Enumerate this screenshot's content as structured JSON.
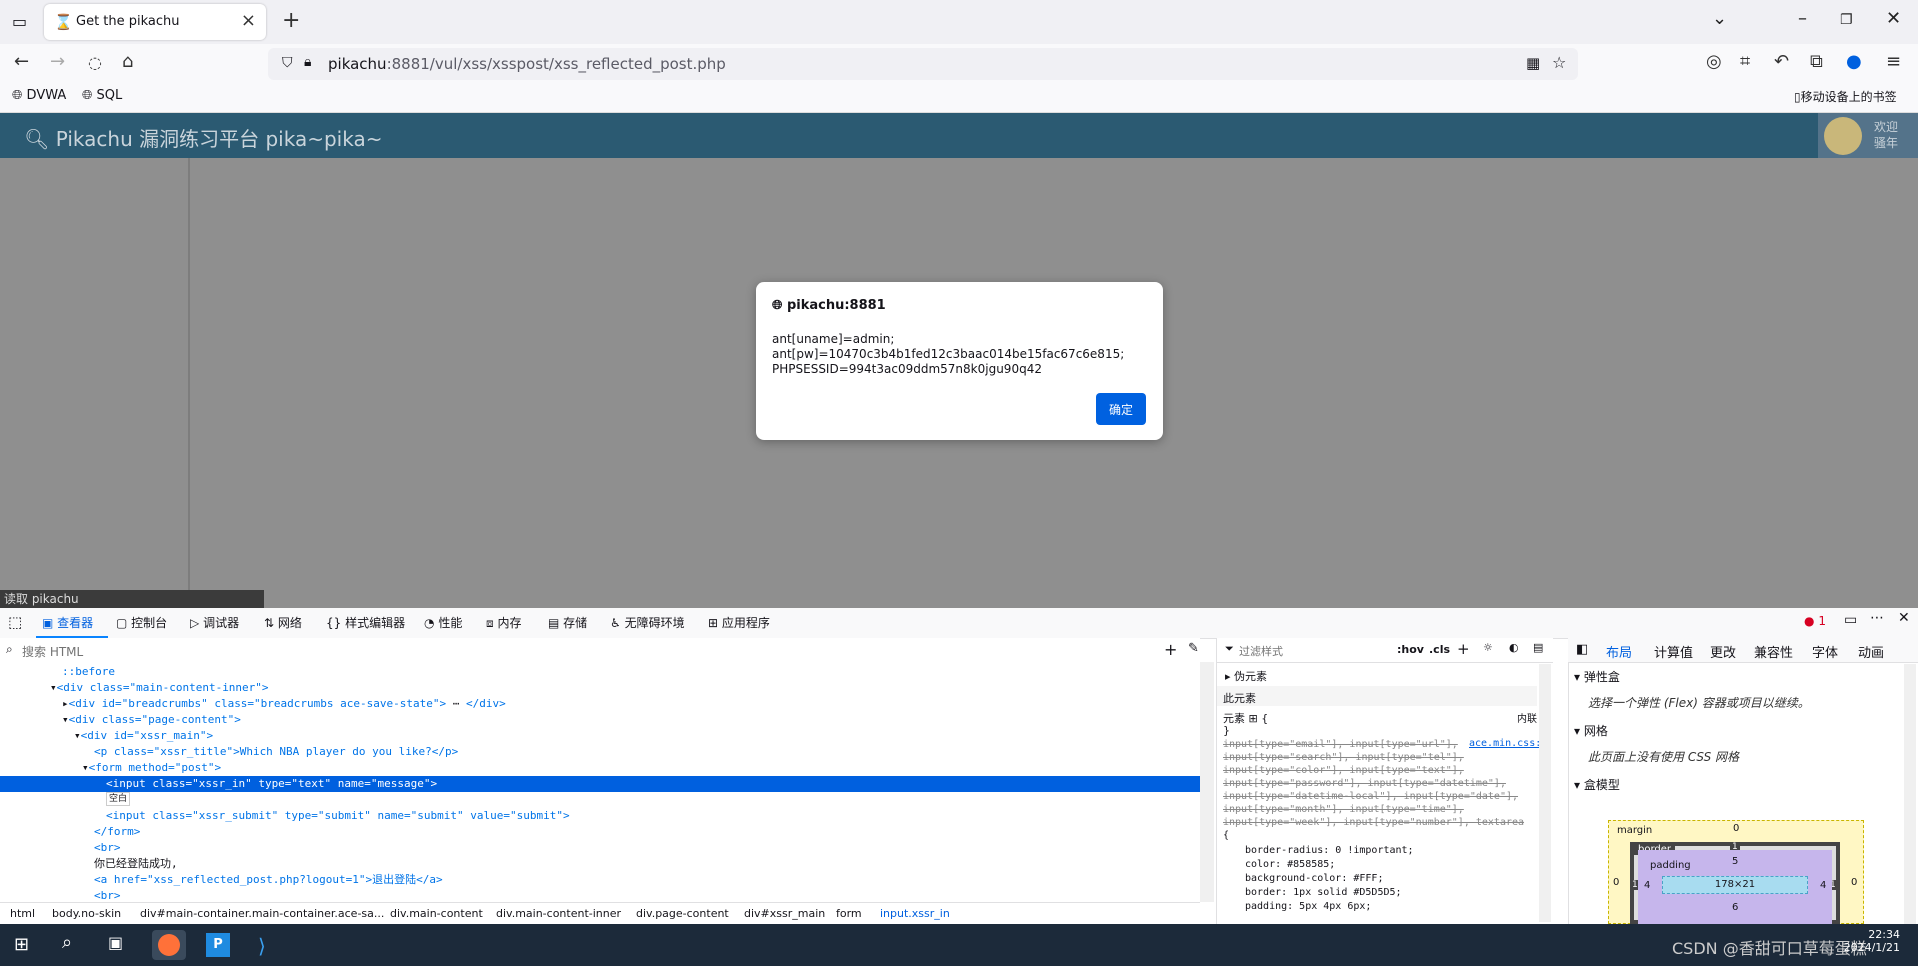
{
  "browser": {
    "tab_title": "Get the pikachu",
    "url_host": "pikachu",
    "url_rest": ":8881/vul/xss/xsspost/xss_reflected_post.php",
    "bookmarks": [
      "DVWA",
      "SQL"
    ],
    "mobile_bookmarks": "移动设备上的书签"
  },
  "page": {
    "brand": "Pikachu 漏洞练习平台 pika~pika~",
    "welcome_line1": "欢迎",
    "welcome_line2": "骚年",
    "status": "读取 pikachu"
  },
  "dialog": {
    "origin": "pikachu:8881",
    "line1": "ant[uname]=admin;",
    "line2": "ant[pw]=10470c3b4b1fed12c3baac014be15fac67c6e815;",
    "line3": "PHPSESSID=994t3ac09ddm57n8k0jgu90q42",
    "ok_label": "确定"
  },
  "devtools": {
    "tabs": [
      "查看器",
      "控制台",
      "调试器",
      "网络",
      "样式编辑器",
      "性能",
      "内存",
      "存储",
      "无障碍环境",
      "应用程序"
    ],
    "error_count": "1",
    "search_placeholder": "搜索 HTML",
    "tree": {
      "before": "::before",
      "l1": "<div class=\"main-content-inner\">",
      "l2": "<div id=\"breadcrumbs\" class=\"breadcrumbs ace-save-state\">",
      "l2b": "</div>",
      "l3": "<div class=\"page-content\">",
      "l4": "<div id=\"xssr_main\">",
      "l5": "<p class=\"xssr_title\">Which NBA player do you like?</p>",
      "l6": "<form method=\"post\">",
      "l7": "<input class=\"xssr_in\" type=\"text\" name=\"message\">",
      "l8": "空白",
      "l9": "<input class=\"xssr_submit\" type=\"submit\" name=\"submit\" value=\"submit\">",
      "l10": "</form>",
      "l11": "<br>",
      "l12": "你已经登陆成功,",
      "l13": "<a href=\"xss_reflected_post.php?logout=1\">退出登陆</a>",
      "l14": "<br>"
    },
    "breadcrumb": [
      "html",
      "body.no-skin",
      "div#main-container.main-container.ace-sa...",
      "div.main-content",
      "div.main-content-inner",
      "div.page-content",
      "div#xssr_main",
      "form",
      "input.xssr_in"
    ],
    "rules": {
      "filter_placeholder": "过滤样式",
      "hov": ":hov",
      "cls": ".cls",
      "pseudo": "伪元素",
      "this_element": "此元素",
      "element": "元素",
      "inline": "内联",
      "brace_open": "{",
      "brace_close": "}",
      "source": "ace.min.css:1",
      "selectors": [
        "input[type=\"email\"], input[type=\"url\"],",
        "input[type=\"search\"], input[type=\"tel\"],",
        "input[type=\"color\"], input[type=\"text\"],",
        "input[type=\"password\"], input[type=\"datetime\"],",
        "input[type=\"datetime-local\"], input[type=\"date\"],",
        "input[type=\"month\"], input[type=\"time\"],",
        "input[type=\"week\"], input[type=\"number\"], textarea"
      ],
      "decls": [
        "border-radius: 0 !important;",
        "color: #858585;",
        "background-color: #FFF;",
        "border: 1px solid #D5D5D5;",
        "padding: 5px 4px 6px;"
      ]
    },
    "layout": {
      "tabs": [
        "布局",
        "计算值",
        "更改",
        "兼容性",
        "字体",
        "动画"
      ],
      "flexbox": "弹性盒",
      "flex_msg": "选择一个弹性 (Flex) 容器或项目以继续。",
      "grid": "网格",
      "grid_msg": "此页面上没有使用 CSS 网格",
      "boxmodel": "盒模型",
      "margin": "margin",
      "border": "border",
      "padding": "padding",
      "content": "178×21",
      "margin_top": "0",
      "padding_top": "5",
      "padding_side": "4",
      "padding_bottom": "6",
      "border_w": "1"
    }
  },
  "taskbar": {
    "time": "22:34",
    "date": "2024/1/21",
    "watermark": "CSDN @香甜可口草莓蛋糕"
  },
  "colors": {
    "accent": "#0060df",
    "header": "#2b5a72"
  }
}
